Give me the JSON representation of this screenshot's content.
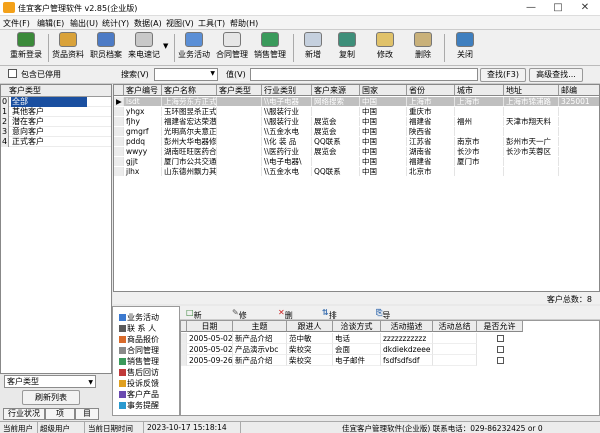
{
  "window": {
    "title": "佳宜客户管理软件 v2.85(企业版)"
  },
  "menu": [
    "文件(F)",
    "编辑(E)",
    "输出(U)",
    "统计(Y)",
    "数据(A)",
    "视图(V)",
    "工具(T)",
    "帮助(H)"
  ],
  "toolbar": {
    "relogin": "重新登录",
    "product": "货品资料",
    "staff": "职员档案",
    "call": "来电速记",
    "activity": "业务活动",
    "contract": "合同管理",
    "sales": "销售管理",
    "new": "新增",
    "copy": "复制",
    "edit": "修改",
    "delete": "删除",
    "close": "关闭"
  },
  "search": {
    "include_disabled": "包含已停用",
    "search_label": "搜索(V)",
    "value_label": "值(V)",
    "find_btn": "查找(F3)",
    "advanced_btn": "高级查找..."
  },
  "left": {
    "header": "客户类型",
    "items": [
      {
        "n": "0",
        "label": "全部"
      },
      {
        "n": "1",
        "label": "其他客户"
      },
      {
        "n": "2",
        "label": "潜在客户"
      },
      {
        "n": "3",
        "label": "意向客户"
      },
      {
        "n": "4",
        "label": "正式客户"
      }
    ],
    "type_select": "客户类型",
    "refresh": "刷新列表",
    "tabs": [
      "行业状况",
      "项",
      "目"
    ]
  },
  "grid": {
    "columns": [
      "客户编号",
      "客户名称",
      "客户类型",
      "行业类别",
      "客户来源",
      "国家",
      "省份",
      "城市",
      "地址",
      "邮编"
    ],
    "rows": [
      [
        "lsdt",
        "上海劳东方正式客户",
        "\\\\电子电器",
        "网络搜索",
        "中国",
        "上海市",
        "上海市",
        "上海市锦浦路",
        "325001"
      ],
      [
        "yhgx",
        "玉环图昱杀正式客户",
        "\\\\服装行业",
        "",
        "中国",
        "重庆市",
        "",
        "",
        ""
      ],
      [
        "fjhy",
        "福建省宏达荣潜在客户",
        "\\\\服装行业",
        "展览会",
        "中国",
        "福建省",
        "福州",
        "天津市翔天料",
        ""
      ],
      [
        "gmgrf",
        "光明高尔夫意正式客户",
        "\\\\五金水电",
        "展览会",
        "中国",
        "陕西省",
        "",
        "",
        ""
      ],
      [
        "pddq",
        "彭州大华电器修改客户",
        "\\\\化 装 品",
        "QQ联系",
        "中国",
        "江苏省",
        "南京市",
        "彭州市天一广",
        ""
      ],
      [
        "wwyy",
        "湖南旺旺医药合同客户",
        "\\\\医药行业",
        "展览会",
        "中国",
        "湖南省",
        "长沙市",
        "长沙市芙蓉区",
        ""
      ],
      [
        "gjjt",
        "厦门市公共交通正式客户",
        "\\\\电子电器\\",
        "",
        "中国",
        "福建省",
        "厦门市",
        "",
        ""
      ],
      [
        "jlhx",
        "山东德州飘力其他客户",
        "\\\\五金水电",
        "QQ联系",
        "中国",
        "北京市",
        "",
        "",
        ""
      ]
    ],
    "count": "客户总数：8"
  },
  "bottom_toolbar": {
    "new": "新增",
    "edit": "修改",
    "delete": "删除",
    "sort": "排序...",
    "export": "导出"
  },
  "nav": [
    "业务活动",
    "联 系 人",
    "商品报价",
    "合同管理",
    "销售管理",
    "售后回访",
    "投诉反馈",
    "客户产品",
    "事务提醒"
  ],
  "activity": {
    "columns": [
      "日期",
      "主题",
      "跟进人",
      "洽谈方式",
      "活动描述",
      "活动总结",
      "是否允许"
    ],
    "rows": [
      [
        "2005-05-02",
        "新产品介绍",
        "范中敏",
        "电话",
        "zzzzzzzzzzz",
        ""
      ],
      [
        "2005-05-02",
        "产品演示vbc",
        "柴校突",
        "会面",
        "dkdiekdzeee",
        ""
      ],
      [
        "2005-09-26",
        "新产品介绍",
        "柴校突",
        "电子邮件",
        "fsdfsdfsdf",
        ""
      ]
    ]
  },
  "status": {
    "user_label": "当前用户",
    "user": "超级用户",
    "datetime_label": "当前日期时间",
    "datetime": "2023-10-17 15:18:14",
    "company": "佳宜客户管理软件(企业版) 联系电话：029-86232425 or 0"
  }
}
